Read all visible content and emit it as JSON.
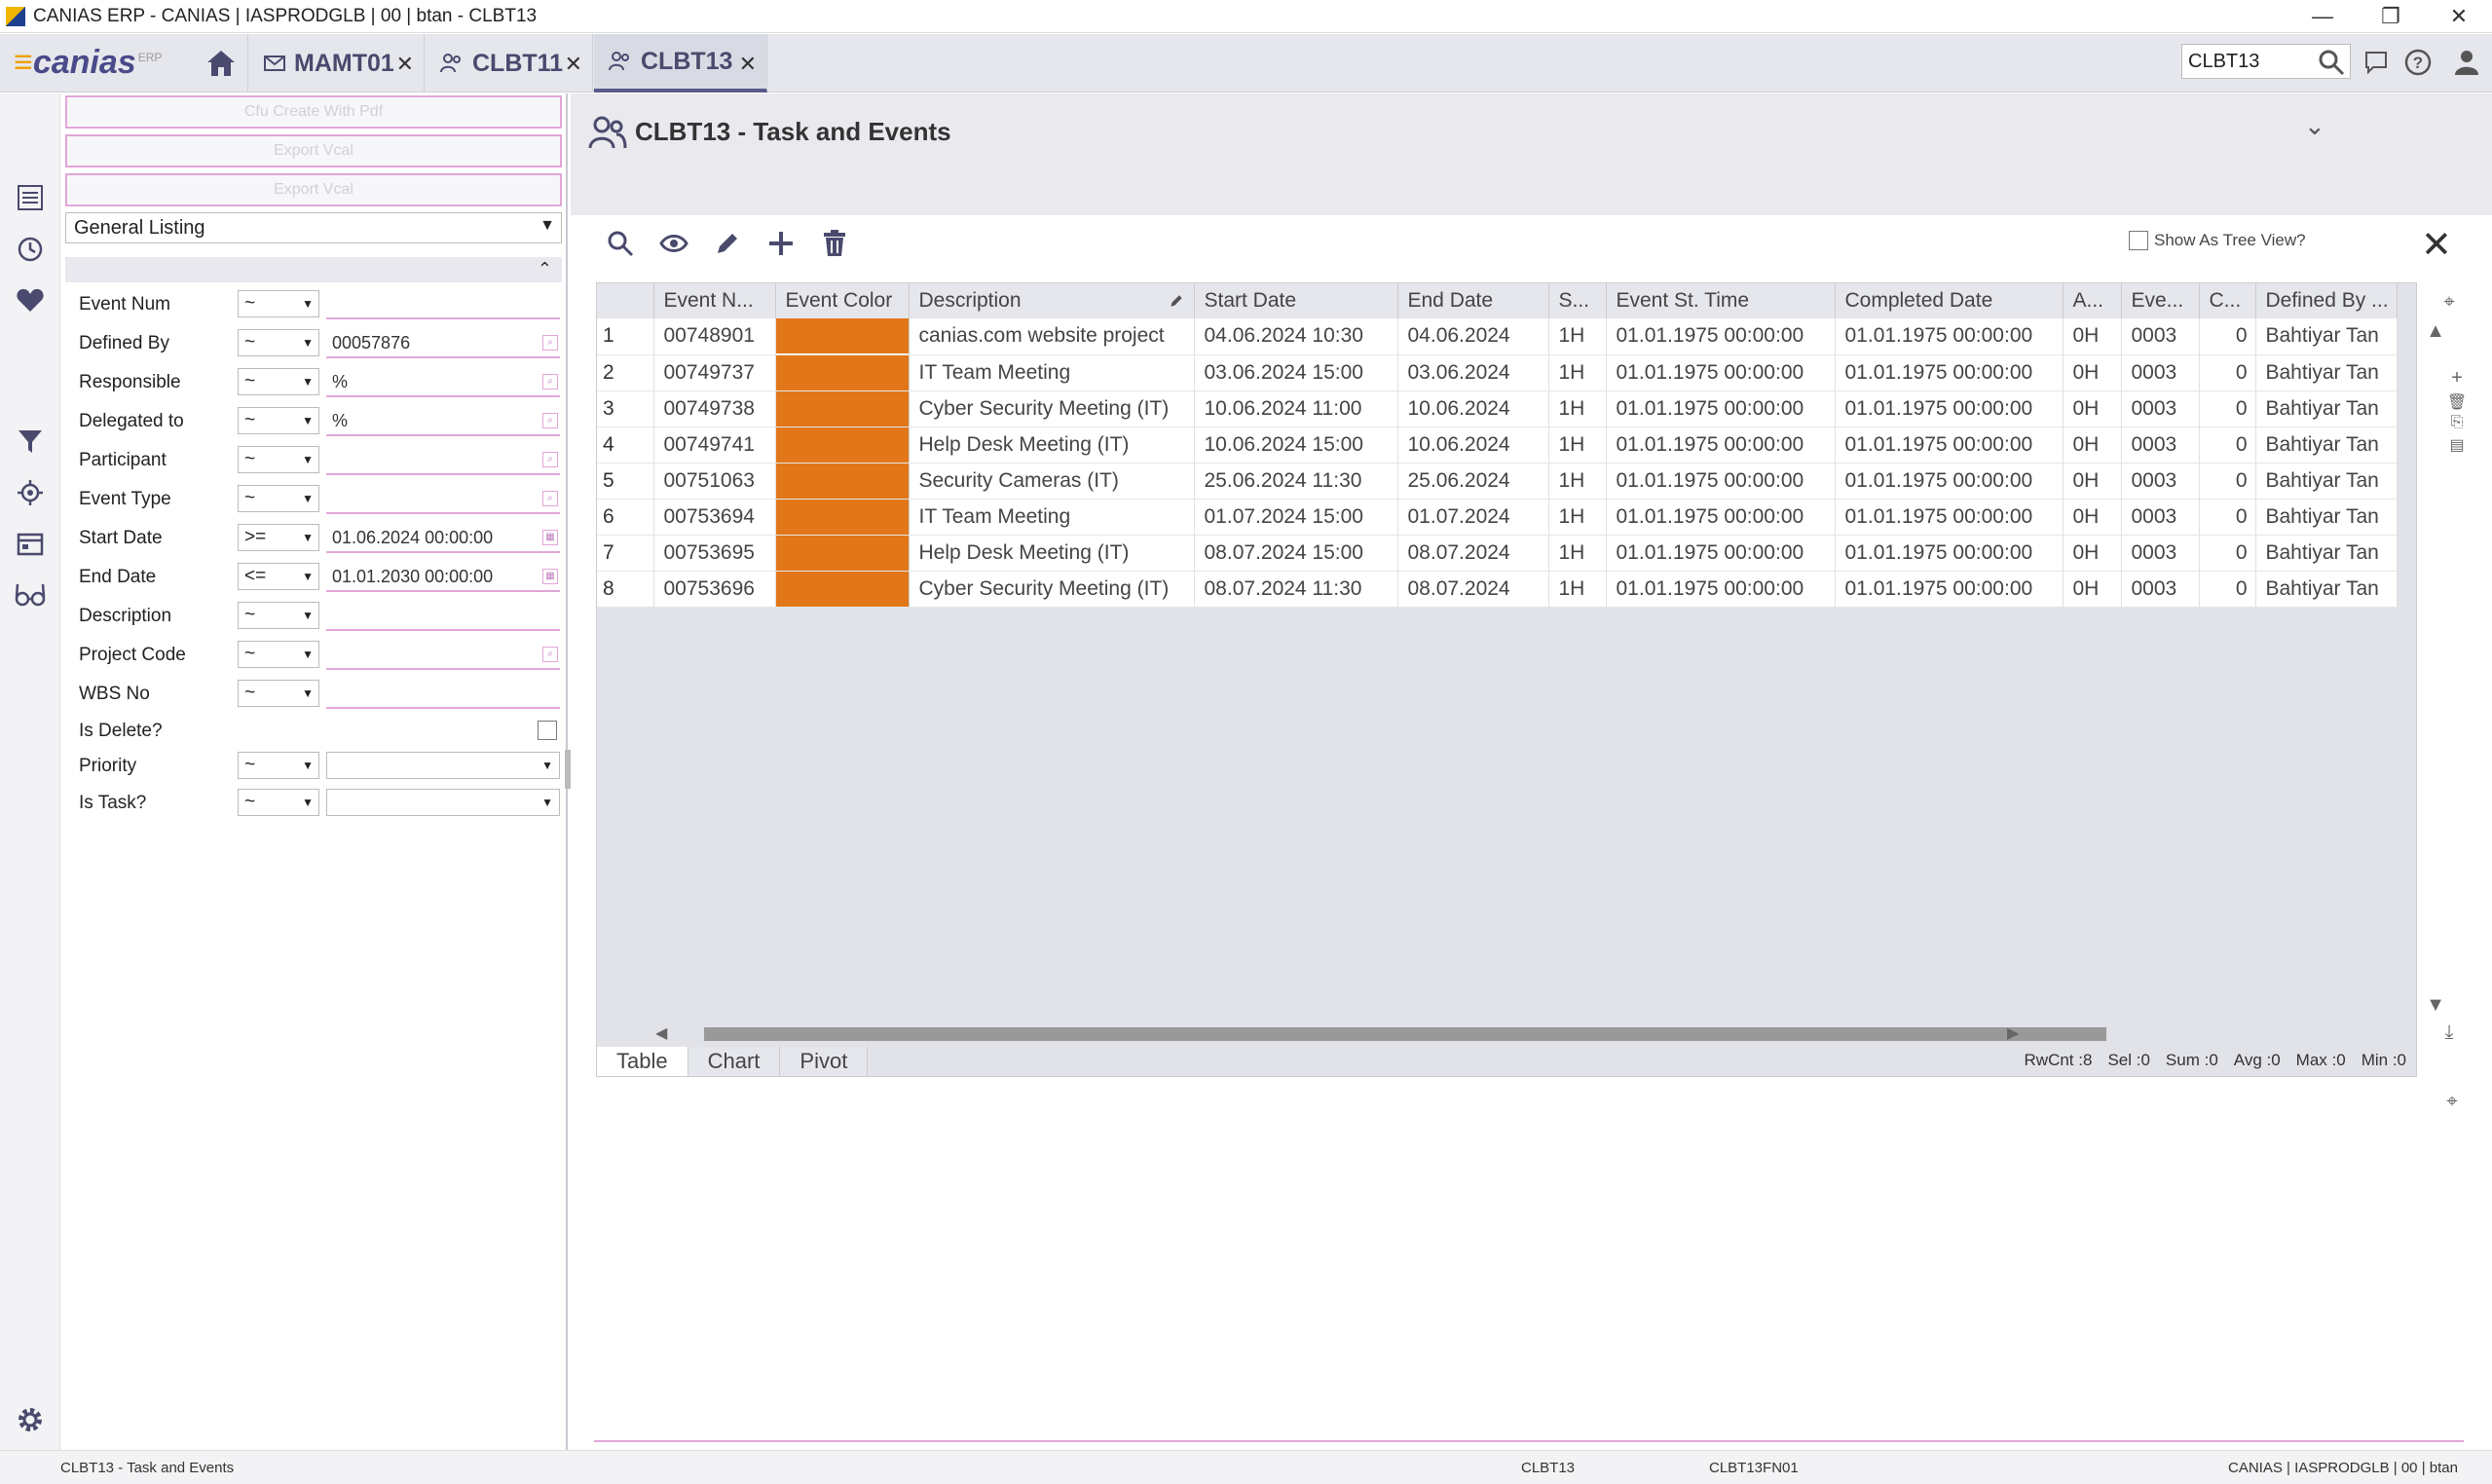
{
  "window": {
    "title": "CANIAS ERP - CANIAS | IASPRODGLB | 00 | btan - CLBT13",
    "minimize": "—",
    "restore": "❐",
    "close": "✕"
  },
  "brand": {
    "name": "canias",
    "sup": "ERP"
  },
  "tabs": [
    {
      "label": "MAMT01"
    },
    {
      "label": "CLBT11"
    },
    {
      "label": "CLBT13"
    }
  ],
  "search": {
    "value": "CLBT13"
  },
  "left": {
    "buttons": [
      "Cfu Create With Pdf",
      "Export Vcal",
      "Export Vcal"
    ],
    "listing": "General Listing",
    "filters": [
      {
        "label": "Event Num",
        "op": "~",
        "value": ""
      },
      {
        "label": "Defined By",
        "op": "~",
        "value": "00057876"
      },
      {
        "label": "Responsible",
        "op": "~",
        "value": "%"
      },
      {
        "label": "Delegated to",
        "op": "~",
        "value": "%"
      },
      {
        "label": "Participant",
        "op": "~",
        "value": ""
      },
      {
        "label": "Event Type",
        "op": "~",
        "value": ""
      },
      {
        "label": "Start Date",
        "op": ">=",
        "value": "01.06.2024 00:00:00"
      },
      {
        "label": "End Date",
        "op": "<=",
        "value": "01.01.2030 00:00:00"
      },
      {
        "label": "Description",
        "op": "~",
        "value": ""
      },
      {
        "label": "Project Code",
        "op": "~",
        "value": ""
      },
      {
        "label": "WBS No",
        "op": "~",
        "value": ""
      },
      {
        "label": "Is Delete?"
      },
      {
        "label": "Priority",
        "op": "~"
      },
      {
        "label": "Is Task?",
        "op": "~"
      }
    ]
  },
  "main": {
    "title": "CLBT13 - Task and Events",
    "tree_view_label": "Show As Tree View?",
    "columns": [
      "Event N...",
      "Event Color",
      "Description",
      "Start Date",
      "End Date",
      "S...",
      "Event St. Time",
      "Completed Date",
      "A...",
      "Eve...",
      "C...",
      "Defined By ..."
    ],
    "rows": [
      {
        "n": "1",
        "event": "00748901",
        "desc": "canias.com website project",
        "start": "04.06.2024 10:30",
        "end": "04.06.2024",
        "s": "1H",
        "est": "01.01.1975 00:00:00",
        "comp": "01.01.1975 00:00:00",
        "a": "0H",
        "eve": "0003",
        "c": "0",
        "def": "Bahtiyar Tan"
      },
      {
        "n": "2",
        "event": "00749737",
        "desc": "IT Team Meeting",
        "start": "03.06.2024 15:00",
        "end": "03.06.2024",
        "s": "1H",
        "est": "01.01.1975 00:00:00",
        "comp": "01.01.1975 00:00:00",
        "a": "0H",
        "eve": "0003",
        "c": "0",
        "def": "Bahtiyar Tan"
      },
      {
        "n": "3",
        "event": "00749738",
        "desc": "Cyber Security Meeting (IT)",
        "start": "10.06.2024 11:00",
        "end": "10.06.2024",
        "s": "1H",
        "est": "01.01.1975 00:00:00",
        "comp": "01.01.1975 00:00:00",
        "a": "0H",
        "eve": "0003",
        "c": "0",
        "def": "Bahtiyar Tan"
      },
      {
        "n": "4",
        "event": "00749741",
        "desc": "Help Desk Meeting (IT)",
        "start": "10.06.2024 15:00",
        "end": "10.06.2024",
        "s": "1H",
        "est": "01.01.1975 00:00:00",
        "comp": "01.01.1975 00:00:00",
        "a": "0H",
        "eve": "0003",
        "c": "0",
        "def": "Bahtiyar Tan"
      },
      {
        "n": "5",
        "event": "00751063",
        "desc": "Security Cameras (IT)",
        "start": "25.06.2024 11:30",
        "end": "25.06.2024",
        "s": "1H",
        "est": "01.01.1975 00:00:00",
        "comp": "01.01.1975 00:00:00",
        "a": "0H",
        "eve": "0003",
        "c": "0",
        "def": "Bahtiyar Tan"
      },
      {
        "n": "6",
        "event": "00753694",
        "desc": "IT Team Meeting",
        "start": "01.07.2024 15:00",
        "end": "01.07.2024",
        "s": "1H",
        "est": "01.01.1975 00:00:00",
        "comp": "01.01.1975 00:00:00",
        "a": "0H",
        "eve": "0003",
        "c": "0",
        "def": "Bahtiyar Tan"
      },
      {
        "n": "7",
        "event": "00753695",
        "desc": "Help Desk Meeting (IT)",
        "start": "08.07.2024 15:00",
        "end": "08.07.2024",
        "s": "1H",
        "est": "01.01.1975 00:00:00",
        "comp": "01.01.1975 00:00:00",
        "a": "0H",
        "eve": "0003",
        "c": "0",
        "def": "Bahtiyar Tan"
      },
      {
        "n": "8",
        "event": "00753696",
        "desc": "Cyber Security Meeting (IT)",
        "start": "08.07.2024 11:30",
        "end": "08.07.2024",
        "s": "1H",
        "est": "01.01.1975 00:00:00",
        "comp": "01.01.1975 00:00:00",
        "a": "0H",
        "eve": "0003",
        "c": "0",
        "def": "Bahtiyar Tan"
      }
    ],
    "event_color": "#e2771a",
    "grid_tabs": [
      "Table",
      "Chart",
      "Pivot"
    ],
    "stats": {
      "rwcnt": "RwCnt :8",
      "sel": "Sel :0",
      "sum": "Sum :0",
      "avg": "Avg :0",
      "max": "Max :0",
      "min": "Min :0"
    }
  },
  "status": {
    "left": "CLBT13 - Task and Events",
    "mid1": "CLBT13",
    "mid2": "CLBT13FN01",
    "right": "CANIAS | IASPRODGLB | 00 | btan"
  },
  "accent": "#e2a6d8"
}
